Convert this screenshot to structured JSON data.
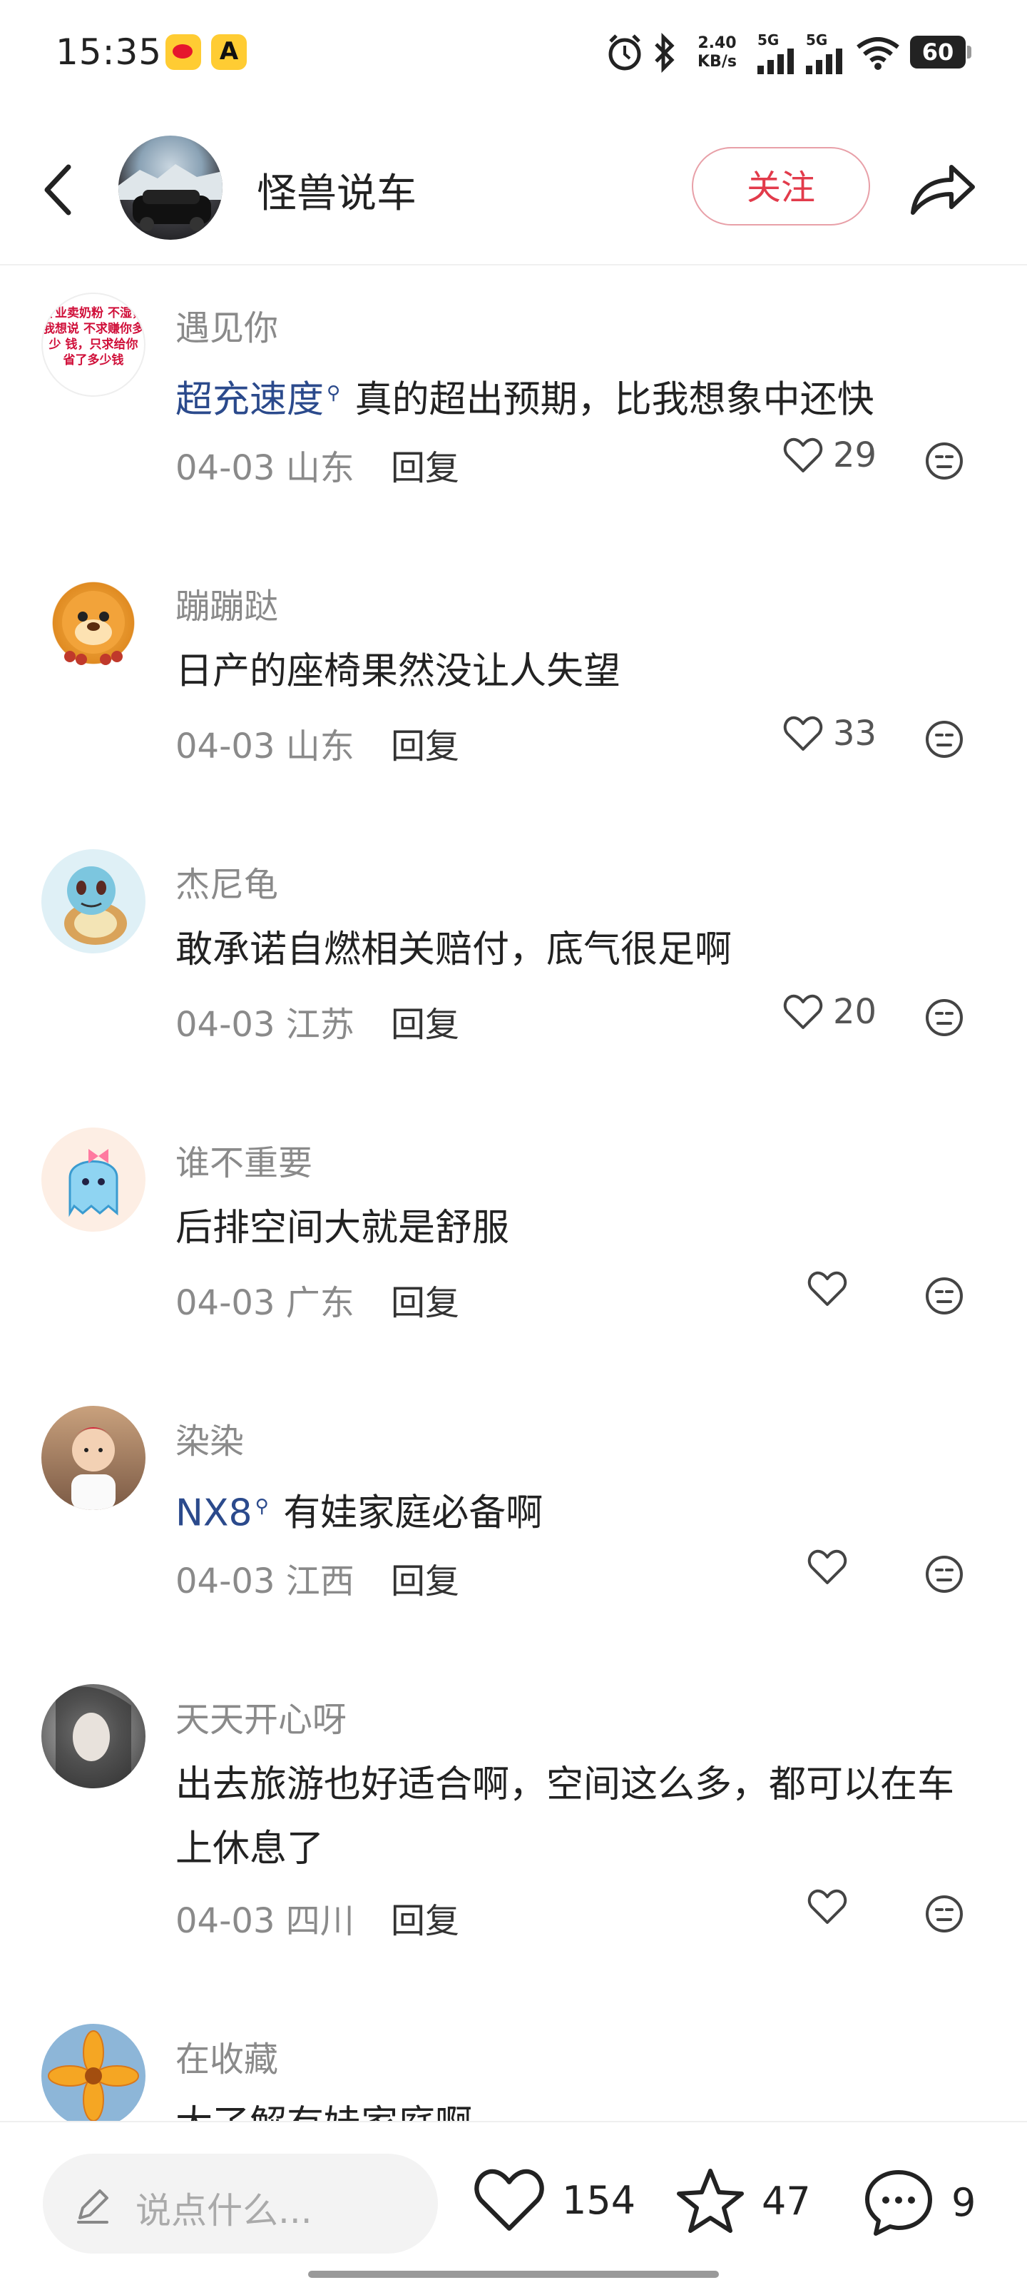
{
  "status_bar": {
    "time": "15:35",
    "speed_top": "2.40",
    "speed_bottom": "KB/s",
    "net1": "5G",
    "net2": "5G",
    "battery": "60"
  },
  "header": {
    "back_icon": "chevron-left-icon",
    "account_name": "怪兽说车",
    "follow_label": "关注",
    "share_icon": "share-arrow-icon"
  },
  "comments": [
    {
      "name": "遇见你",
      "tag": "超充速度",
      "text": "真的超出预期，比我想象中还快",
      "date": "04-03",
      "region": "山东",
      "reply": "回复",
      "likes": "29"
    },
    {
      "name": "蹦蹦跶",
      "tag": "",
      "text": "日产的座椅果然没让人失望",
      "date": "04-03",
      "region": "山东",
      "reply": "回复",
      "likes": "33"
    },
    {
      "name": "杰尼龟",
      "tag": "",
      "text": "敢承诺自燃相关赔付，底气很足啊",
      "date": "04-03",
      "region": "江苏",
      "reply": "回复",
      "likes": "20"
    },
    {
      "name": "谁不重要",
      "tag": "",
      "text": "后排空间大就是舒服",
      "date": "04-03",
      "region": "广东",
      "reply": "回复",
      "likes": ""
    },
    {
      "name": "染染",
      "tag": "NX8",
      "text": "有娃家庭必备啊",
      "date": "04-03",
      "region": "江西",
      "reply": "回复",
      "likes": ""
    },
    {
      "name": "天天开心呀",
      "tag": "",
      "text": "出去旅游也好适合啊，空间这么多，都可以在车上休息了",
      "date": "04-03",
      "region": "四川",
      "reply": "回复",
      "likes": ""
    },
    {
      "name": "在收藏",
      "tag": "",
      "text": "太了解有娃家庭啊",
      "date": "",
      "region": "",
      "reply": "",
      "likes": ""
    }
  ],
  "avatar_text_1": "专业卖奶粉 不湿，我想说 不求赚你多少 钱，只求给你 省了多少钱",
  "bottom_bar": {
    "input_placeholder": "说点什么...",
    "likes": "154",
    "favorites": "47",
    "comments": "9"
  },
  "colors": {
    "accent_red": "#e23b4b",
    "tag_blue": "#2b4a8c",
    "meta_gray": "#8a8a8a"
  }
}
